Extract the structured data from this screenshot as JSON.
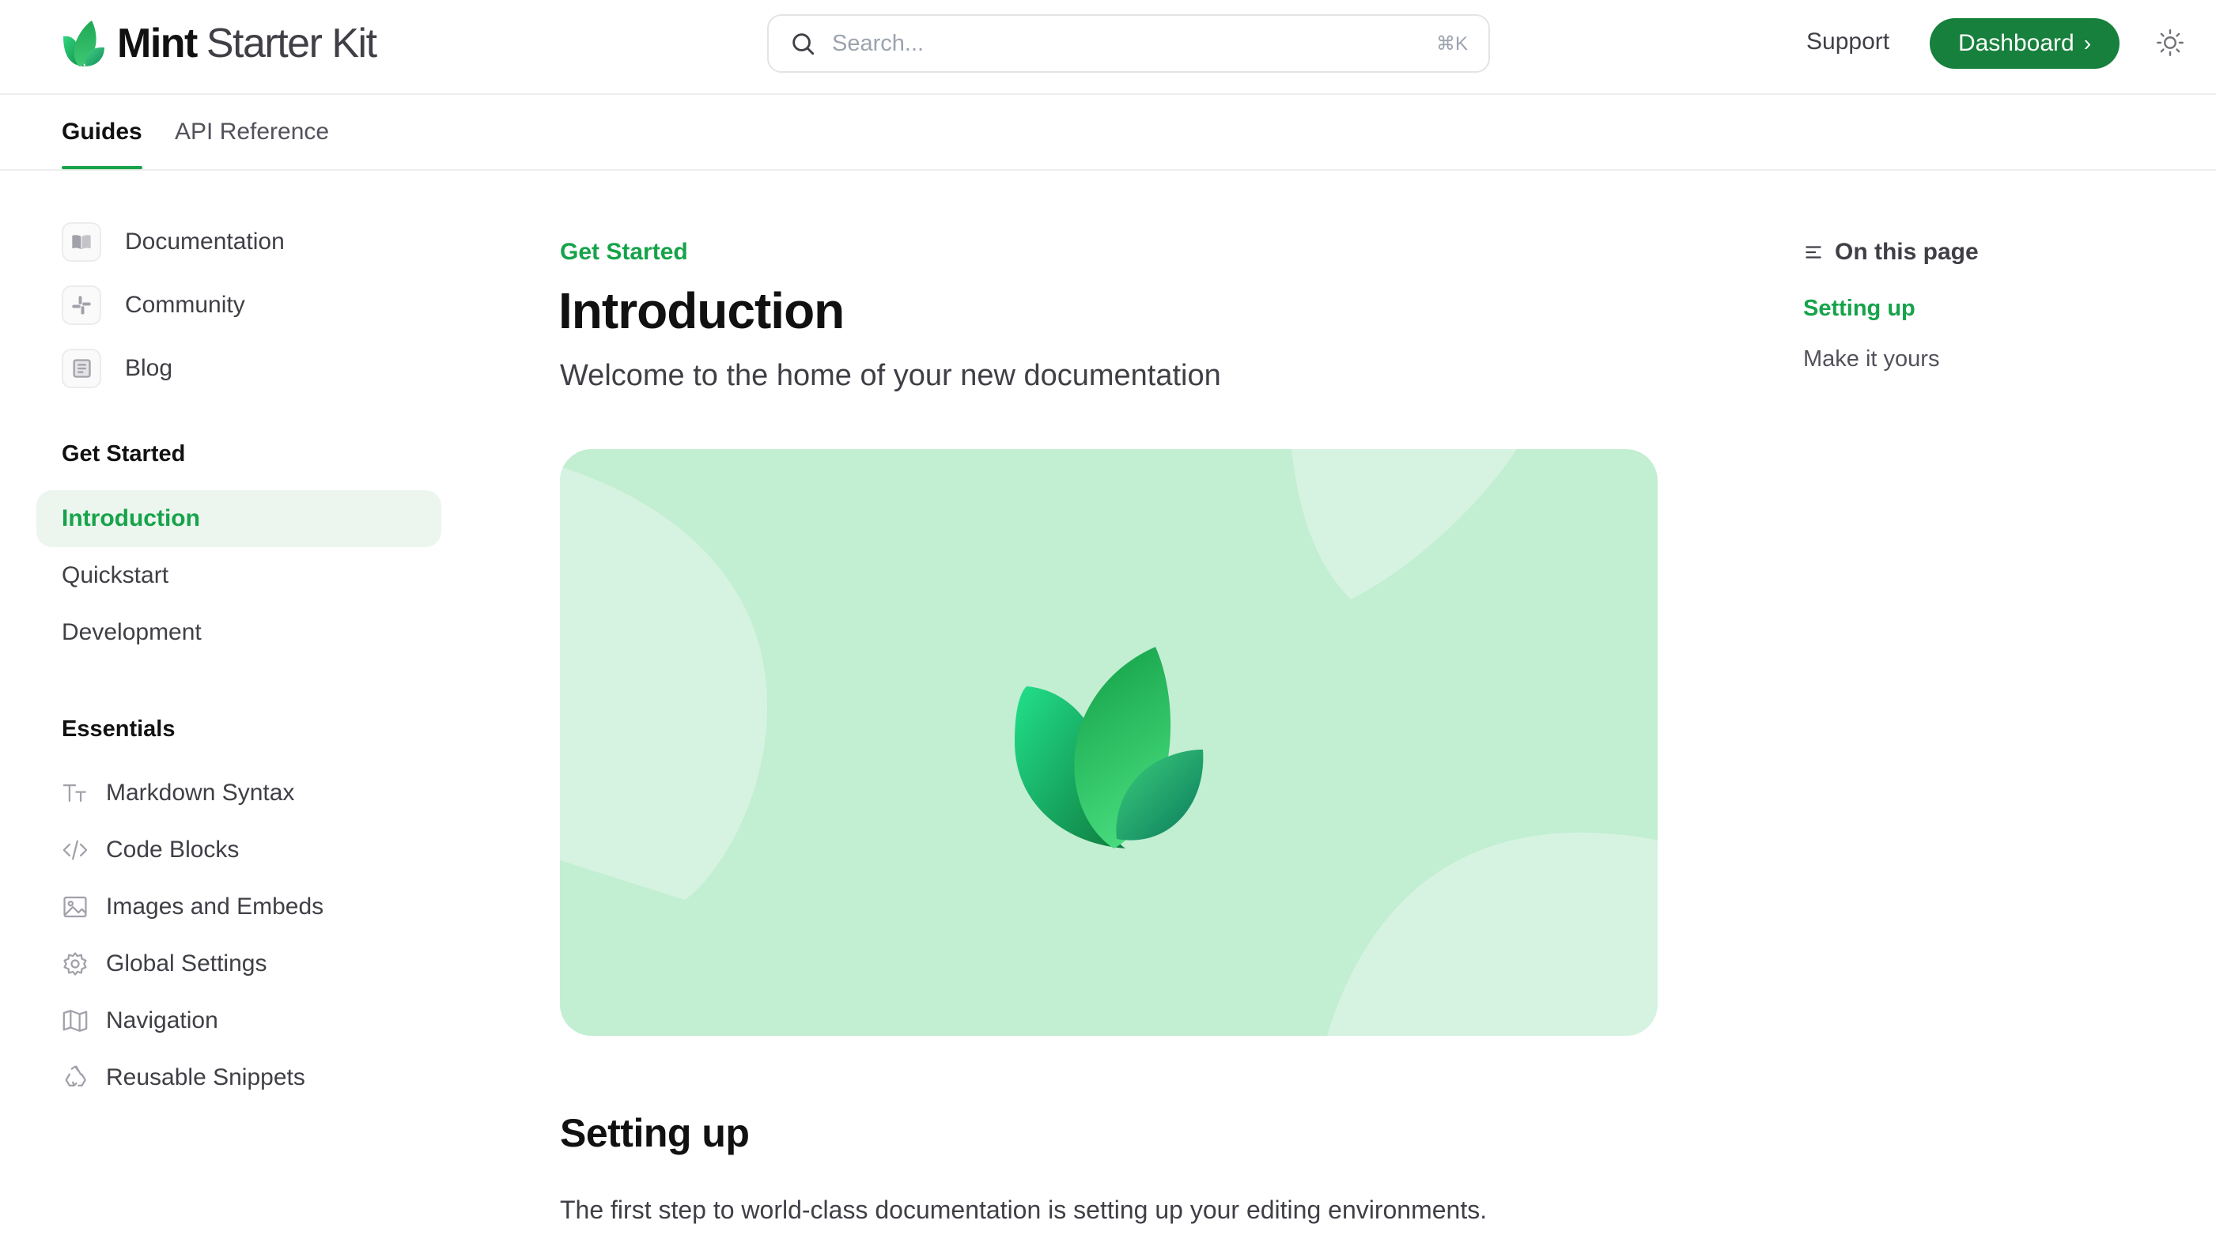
{
  "brand": {
    "name_bold": "Mint",
    "name_regular": "Starter Kit"
  },
  "search": {
    "placeholder": "Search...",
    "shortcut": "⌘K"
  },
  "header": {
    "support_label": "Support",
    "dashboard_label": "Dashboard",
    "accent_color": "#16803c"
  },
  "tabs": [
    {
      "label": "Guides",
      "active": true
    },
    {
      "label": "API Reference",
      "active": false
    }
  ],
  "sidebar": {
    "anchors": [
      {
        "label": "Documentation",
        "icon": "book-icon"
      },
      {
        "label": "Community",
        "icon": "slack-icon"
      },
      {
        "label": "Blog",
        "icon": "newspaper-icon"
      }
    ],
    "groups": [
      {
        "title": "Get Started",
        "items": [
          {
            "label": "Introduction",
            "active": true
          },
          {
            "label": "Quickstart"
          },
          {
            "label": "Development"
          }
        ]
      },
      {
        "title": "Essentials",
        "items": [
          {
            "label": "Markdown Syntax",
            "icon": "text-size-icon"
          },
          {
            "label": "Code Blocks",
            "icon": "code-icon"
          },
          {
            "label": "Images and Embeds",
            "icon": "image-icon"
          },
          {
            "label": "Global Settings",
            "icon": "gear-icon"
          },
          {
            "label": "Navigation",
            "icon": "map-icon"
          },
          {
            "label": "Reusable Snippets",
            "icon": "recycle-icon"
          }
        ]
      }
    ]
  },
  "content": {
    "eyebrow": "Get Started",
    "title": "Introduction",
    "description": "Welcome to the home of your new documentation",
    "hero_icon": "mint-leaf-logo",
    "section_title": "Setting up",
    "section_text": "The first step to world-class documentation is setting up your editing environments."
  },
  "toc": {
    "title": "On this page",
    "items": [
      {
        "label": "Setting up",
        "active": true
      },
      {
        "label": "Make it yours",
        "active": false
      }
    ]
  }
}
